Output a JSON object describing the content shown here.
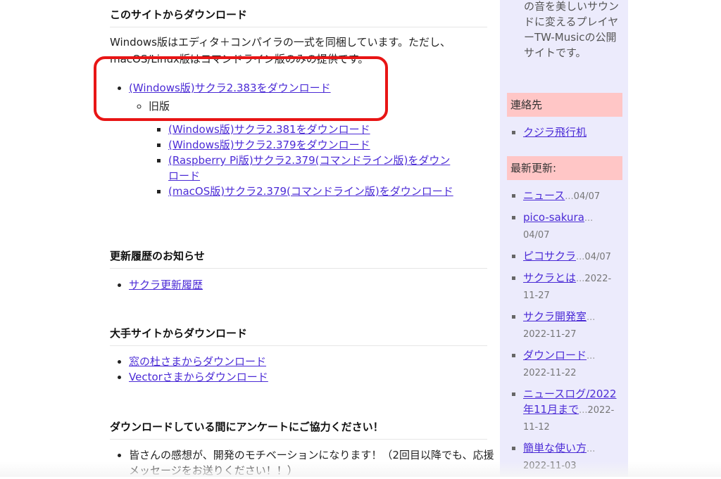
{
  "sections": {
    "download": {
      "heading": "このサイトからダウンロード",
      "intro_line1": "Windows版はエディタ＋コンパイラの一式を同梱しています。ただし、",
      "intro_line2": "macOS/Linux版はコマンドライン版のみの提供です。",
      "main_link": "(Windows版)サクラ2.383をダウンロード",
      "old_label": "旧版",
      "old_links": [
        "(Windows版)サクラ2.381をダウンロード",
        "(Windows版)サクラ2.379をダウンロード",
        "(Raspberry Pi版)サクラ2.379(コマンドライン版)をダウンロード",
        "(macOS版)サクラ2.379(コマンドライン版)をダウンロード"
      ]
    },
    "history": {
      "heading": "更新履歴のお知らせ",
      "link": "サクラ更新履歴"
    },
    "big_sites": {
      "heading": "大手サイトからダウンロード",
      "links": [
        "窓の杜さまからダウンロード",
        "Vectorさまからダウンロード"
      ]
    },
    "survey": {
      "heading": "ダウンロードしている間にアンケートにご協力ください！",
      "item": "皆さんの感想が、開発のモチベーションになります！（2回目以降でも、応援メッセージをお送りください！！）"
    }
  },
  "sidebar": {
    "about_text": "の音を美しいサウンドに変えるプレイヤーTW-Musicの公開サイトです。",
    "contact": {
      "heading": "連絡先",
      "link": "クジラ飛行机"
    },
    "recent": {
      "heading": "最新更新:",
      "items": [
        {
          "title": "ニュース",
          "date": "04/07"
        },
        {
          "title": "pico-sakura",
          "date": "04/07"
        },
        {
          "title": "ピコサクラ",
          "date": "04/07"
        },
        {
          "title": "サクラとは",
          "date": "2022-11-27"
        },
        {
          "title": "サクラ開発室",
          "date": "2022-11-27"
        },
        {
          "title": "ダウンロード",
          "date": "2022-11-22"
        },
        {
          "title": "ニュースログ/2022年11月まで",
          "date": "2022-11-12"
        },
        {
          "title": "簡単な使い方",
          "date": "2022-11-03"
        }
      ]
    }
  },
  "colors": {
    "link": "#4b2bd6",
    "sidebar_bg": "#ecebfc",
    "sidebar_heading_bg": "#ffc6c6",
    "highlight_border": "#e81515"
  }
}
